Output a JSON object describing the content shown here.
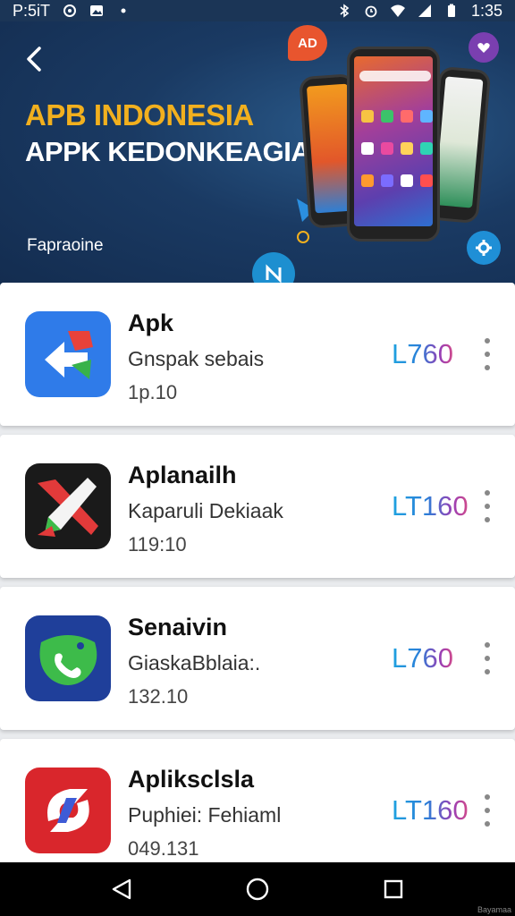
{
  "status_bar": {
    "left_text": "P:5iT",
    "time": "1:35",
    "icons": [
      "circle-status-icon",
      "image-icon",
      "dot-icon",
      "bluetooth-icon",
      "alarm-icon",
      "wifi-icon",
      "signal-icon",
      "battery-icon"
    ]
  },
  "header": {
    "title": "APB INDONESIA",
    "subtitle": "APPK KEDONKEAGIA",
    "caption": "Fapraoine",
    "back_icon": "chevron-left-icon",
    "badge_text": "AD"
  },
  "apps": [
    {
      "name": "Apk",
      "desc": "Gnspak sebais",
      "meta": "1p.10",
      "price": "L760",
      "icon": "arrow-app-icon",
      "colors": [
        "#2f7be9",
        "#e8423a"
      ]
    },
    {
      "name": "Aplanailh",
      "desc": "Kaparuli Dekiaak",
      "meta": "119:10",
      "price": "LT160",
      "icon": "rocket-app-icon",
      "colors": [
        "#1a1a1a",
        "#e23a3a"
      ]
    },
    {
      "name": "Senaivin",
      "desc": "GiaskaBblaia:.",
      "meta": "132.10",
      "price": "L760",
      "icon": "phone-app-icon",
      "colors": [
        "#1f3f9a",
        "#3dbb4a"
      ]
    },
    {
      "name": "Apliksclsla",
      "desc": "Puphiei: Fehiaml",
      "meta": "049.131",
      "price": "LT160",
      "icon": "swirl-app-icon",
      "colors": [
        "#d9262c",
        "#3e5bd6"
      ]
    }
  ],
  "nav": {
    "back_icon": "back-triangle-icon",
    "home_icon": "home-circle-icon",
    "recents_icon": "recents-square-icon"
  },
  "watermark": "Bayamaa"
}
